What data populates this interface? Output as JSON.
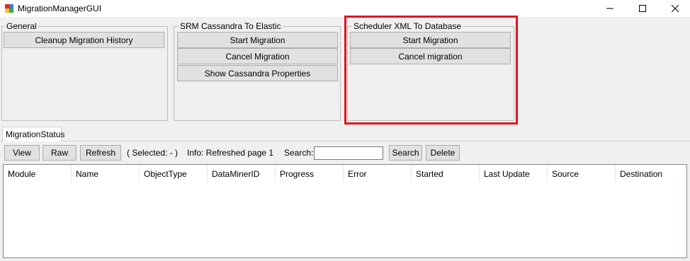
{
  "window": {
    "title": "MigrationManagerGUI",
    "controls": [
      "minimize",
      "maximize",
      "close"
    ]
  },
  "groups": {
    "general": {
      "title": "General",
      "buttons": [
        "Cleanup Migration History"
      ]
    },
    "srm": {
      "title": "SRM Cassandra To Elastic",
      "buttons": [
        "Start Migration",
        "Cancel Migration",
        "Show Cassandra Properties"
      ]
    },
    "scheduler": {
      "title": "Scheduler XML To Database",
      "buttons": [
        "Start Migration",
        "Cancel migration"
      ]
    }
  },
  "highlight_color": "#e0141e",
  "tabs": [
    {
      "label": "MigrationStatus",
      "selected": true
    }
  ],
  "toolbar": {
    "view_label": "View",
    "raw_label": "Raw",
    "refresh_label": "Refresh",
    "selected_text": "( Selected: - )",
    "info_text": "Info: Refreshed page 1",
    "search_label": "Search:",
    "search_value": "",
    "search_button_label": "Search",
    "delete_label": "Delete"
  },
  "table": {
    "columns": [
      "Module",
      "Name",
      "ObjectType",
      "DataMinerID",
      "Progress",
      "Error",
      "Started",
      "Last Update",
      "Source",
      "Destination"
    ],
    "rows": []
  }
}
